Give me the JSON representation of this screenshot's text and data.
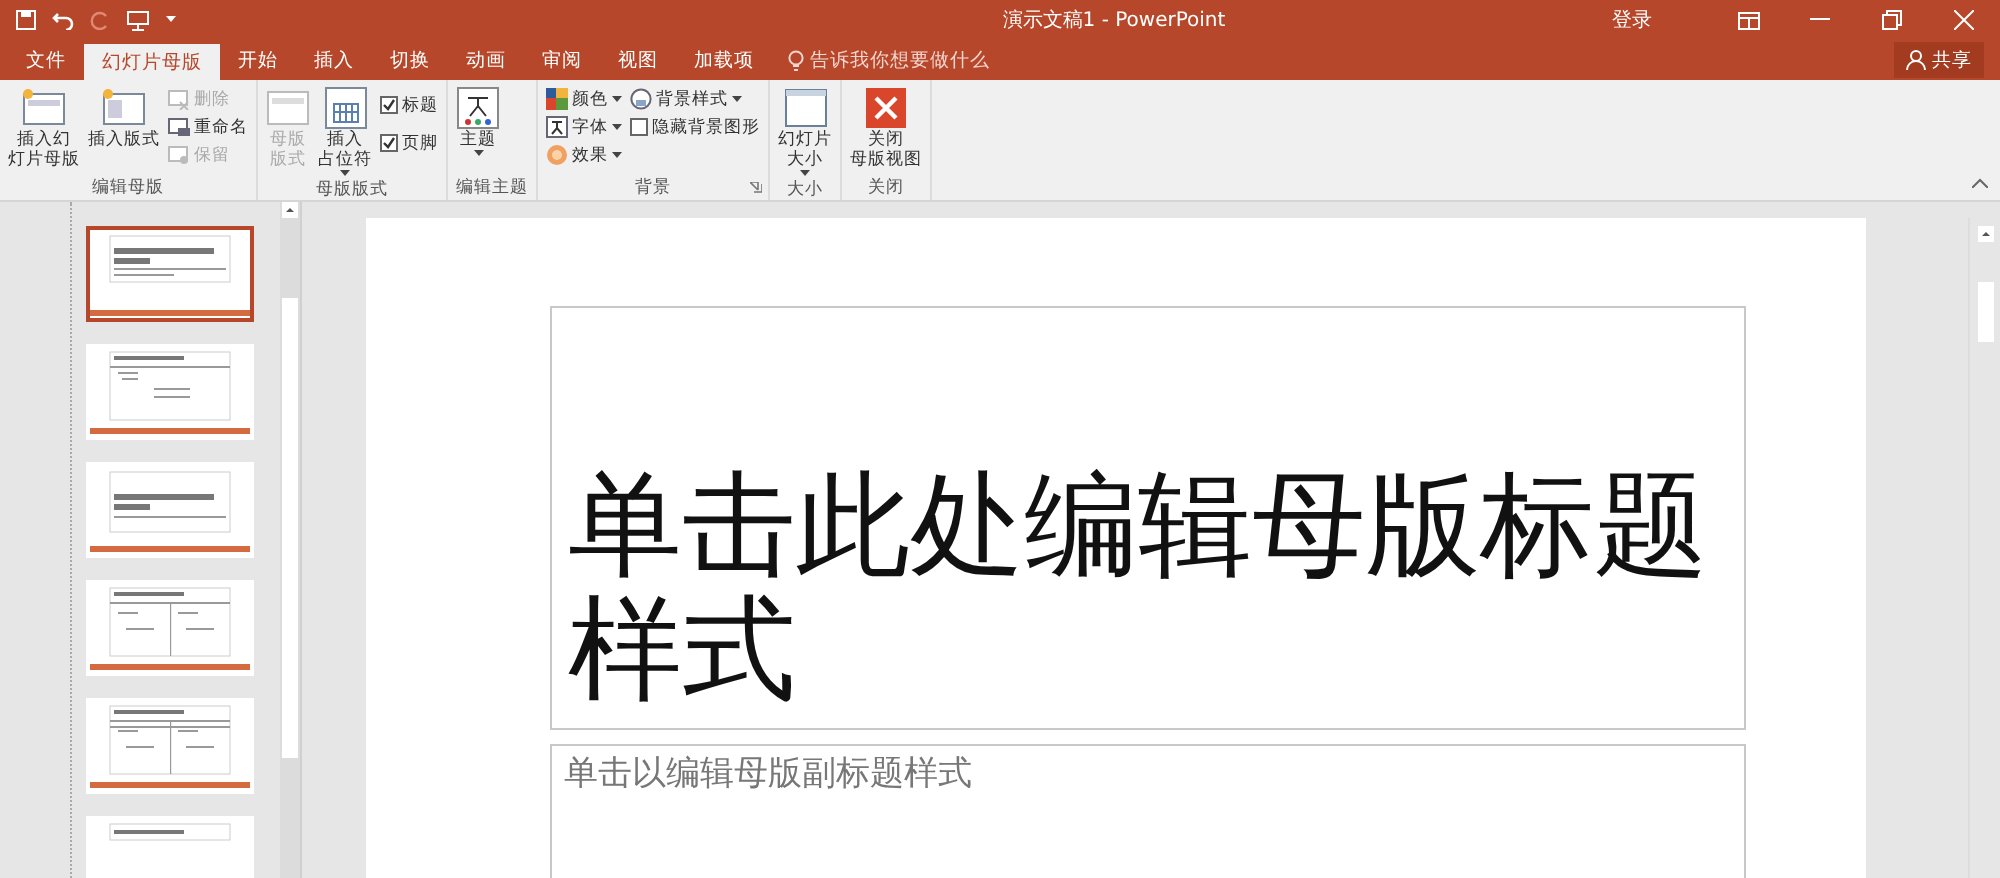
{
  "window": {
    "title": "演示文稿1 - PowerPoint",
    "sign_in": "登录"
  },
  "quick_access": [
    {
      "kind": "save",
      "disabled": false
    },
    {
      "kind": "undo",
      "disabled": false
    },
    {
      "kind": "redo",
      "disabled": true
    },
    {
      "kind": "slideshow",
      "disabled": false
    }
  ],
  "tabs": [
    {
      "label": "文件",
      "selected": false
    },
    {
      "label": "幻灯片母版",
      "selected": true
    },
    {
      "label": "开始",
      "selected": false
    },
    {
      "label": "插入",
      "selected": false
    },
    {
      "label": "切换",
      "selected": false
    },
    {
      "label": "动画",
      "selected": false
    },
    {
      "label": "审阅",
      "selected": false
    },
    {
      "label": "视图",
      "selected": false
    },
    {
      "label": "加载项",
      "selected": false
    }
  ],
  "tell_me": {
    "placeholder": "告诉我你想要做什么"
  },
  "share": "共享",
  "ribbon": [
    {
      "label": "编辑母版",
      "items": [
        {
          "kind": "large",
          "lines": [
            "插入幻",
            "灯片母版"
          ],
          "disabled": false
        },
        {
          "kind": "large",
          "lines": [
            "插入版式"
          ],
          "disabled": false
        },
        {
          "kind": "stack",
          "items": [
            {
              "kind": "button",
              "label": "删除",
              "disabled": true
            },
            {
              "kind": "button",
              "label": "重命名",
              "disabled": false
            },
            {
              "kind": "button",
              "label": "保留",
              "disabled": true
            }
          ]
        }
      ]
    },
    {
      "label": "母版版式",
      "items": [
        {
          "kind": "large",
          "lines": [
            "母版",
            "版式"
          ],
          "disabled": true
        },
        {
          "kind": "large",
          "lines": [
            "插入",
            "占位符"
          ],
          "caret": true,
          "disabled": false
        },
        {
          "kind": "checks",
          "items": [
            {
              "label": "标题",
              "checked": true
            },
            {
              "label": "页脚",
              "checked": true
            }
          ]
        }
      ]
    },
    {
      "label": "编辑主题",
      "items": [
        {
          "kind": "large",
          "lines": [
            "主题"
          ],
          "caret": true,
          "disabled": false
        }
      ]
    },
    {
      "label": "背景",
      "launcher": true,
      "items": [
        {
          "kind": "stack",
          "items": [
            {
              "kind": "button",
              "label": "颜色",
              "caret": true,
              "disabled": false
            },
            {
              "kind": "button",
              "label": "字体",
              "caret": true,
              "disabled": false
            },
            {
              "kind": "button",
              "label": "效果",
              "caret": true,
              "disabled": false
            }
          ]
        },
        {
          "kind": "stack",
          "items": [
            {
              "kind": "button",
              "label": "背景样式",
              "caret": true,
              "disabled": false
            },
            {
              "kind": "check",
              "label": "隐藏背景图形",
              "checked": false
            }
          ]
        }
      ]
    },
    {
      "label": "大小",
      "items": [
        {
          "kind": "large",
          "lines": [
            "幻灯片",
            "大小"
          ],
          "caret": true,
          "disabled": false
        }
      ]
    },
    {
      "label": "关闭",
      "items": [
        {
          "kind": "large",
          "lines": [
            "关闭",
            "母版视图"
          ],
          "disabled": false
        }
      ]
    }
  ],
  "thumbnails": [
    {
      "kind": "title",
      "selected": true
    },
    {
      "kind": "content",
      "selected": false
    },
    {
      "kind": "section",
      "selected": false
    },
    {
      "kind": "two",
      "selected": false
    },
    {
      "kind": "compare",
      "selected": false
    },
    {
      "kind": "titleonly",
      "selected": false
    }
  ],
  "slide": {
    "title": "单击此处编辑母版标题样式",
    "subtitle": "单击以编辑母版副标题样式"
  }
}
